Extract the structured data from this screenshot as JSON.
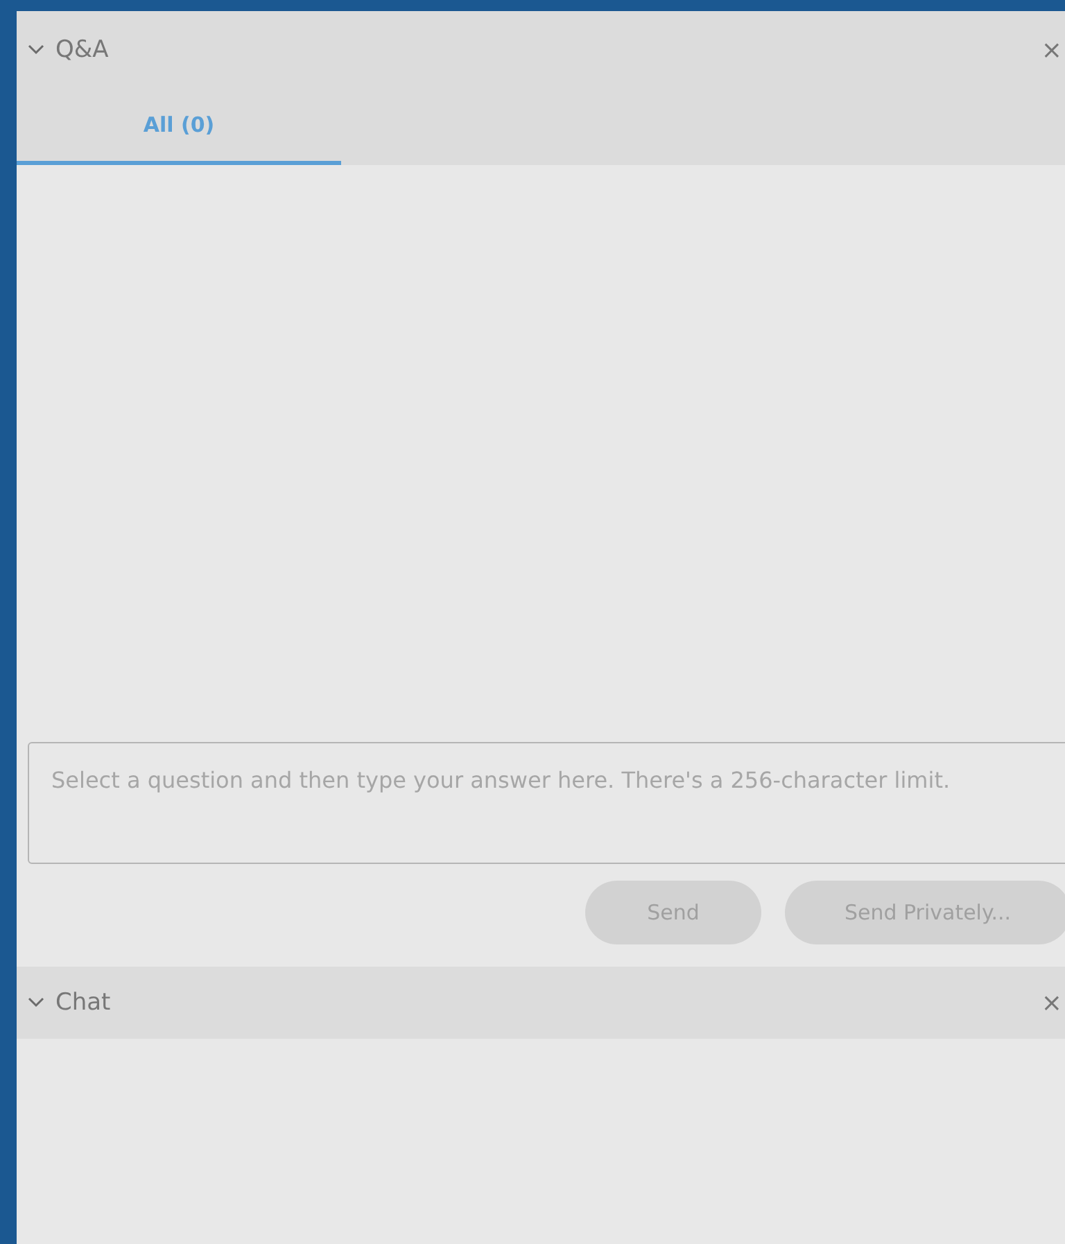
{
  "qa_panel": {
    "title": "Q&A",
    "expanded": true,
    "close": "×",
    "tabs": [
      {
        "label": "All (0)",
        "selected": true
      }
    ],
    "answer": {
      "placeholder": "Select a question and then type your answer here. There's a 256-character limit."
    },
    "buttons": [
      {
        "label": "Send",
        "disabled": true
      },
      {
        "label": "Send Privately...",
        "disabled": true
      }
    ]
  },
  "chat_panel": {
    "title": "Chat",
    "expanded": true,
    "close": "×"
  }
}
